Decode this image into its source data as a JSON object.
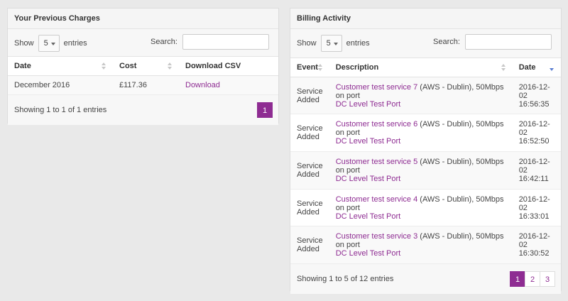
{
  "charges": {
    "title": "Your Previous Charges",
    "show_label": "Show",
    "entries_value": "5",
    "entries_label": "entries",
    "search_label": "Search:",
    "columns": [
      "Date",
      "Cost",
      "Download CSV"
    ],
    "rows": [
      {
        "date": "December 2016",
        "cost": "£117.36",
        "download": "Download"
      }
    ],
    "info": "Showing 1 to 1 of 1 entries",
    "pages": [
      "1"
    ]
  },
  "billing": {
    "title": "Billing Activity",
    "show_label": "Show",
    "entries_value": "5",
    "entries_label": "entries",
    "search_label": "Search:",
    "columns": [
      "Event",
      "Description",
      "Date"
    ],
    "rows": [
      {
        "event_1": "Service",
        "event_2": "Added",
        "service": "Customer test service 7",
        "detail": " (AWS - Dublin), 50Mbps on port",
        "port": "DC Level Test Port",
        "date_1": "2016-12-",
        "date_2": "02",
        "date_3": "16:56:35"
      },
      {
        "event_1": "Service",
        "event_2": "Added",
        "service": "Customer test service 6",
        "detail": " (AWS - Dublin), 50Mbps on port",
        "port": "DC Level Test Port",
        "date_1": "2016-12-",
        "date_2": "02",
        "date_3": "16:52:50"
      },
      {
        "event_1": "Service",
        "event_2": "Added",
        "service": "Customer test service 5",
        "detail": " (AWS - Dublin), 50Mbps on port",
        "port": "DC Level Test Port",
        "date_1": "2016-12-",
        "date_2": "02",
        "date_3": "16:42:11"
      },
      {
        "event_1": "Service",
        "event_2": "Added",
        "service": "Customer test service 4",
        "detail": " (AWS - Dublin), 50Mbps on port",
        "port": "DC Level Test Port",
        "date_1": "2016-12-",
        "date_2": "02",
        "date_3": "16:33:01"
      },
      {
        "event_1": "Service",
        "event_2": "Added",
        "service": "Customer test service 3",
        "detail": " (AWS - Dublin), 50Mbps on port",
        "port": "DC Level Test Port",
        "date_1": "2016-12-",
        "date_2": "02",
        "date_3": "16:30:52"
      }
    ],
    "info": "Showing 1 to 5 of 12 entries",
    "pages": [
      "1",
      "2",
      "3"
    ]
  },
  "colors": {
    "accent": "#8e2c92",
    "sort_active": "#5a7ed1",
    "background": "#e9e9e9"
  }
}
